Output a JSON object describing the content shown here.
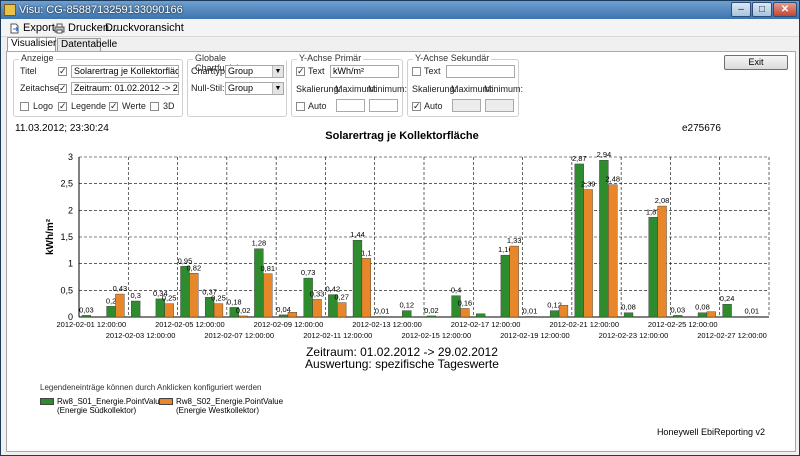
{
  "window": {
    "title": "Visu: CG-8588713259133090166",
    "minimize": "–",
    "maximize": "□",
    "close": "✕"
  },
  "toolbar": {
    "export": "Export",
    "print": "Drucken...",
    "preview": "Druckvoransicht"
  },
  "tabs": [
    "Visualisierung",
    "Datentabelle"
  ],
  "anzeige": {
    "group_label": "Anzeige",
    "titel_label": "Titel",
    "titel_checked": true,
    "titel_value": "Solarertrag je Kollektorfläche",
    "zeitachse_label": "Zeitachse",
    "zeitachse_checked": true,
    "zeitachse_value": "Zeitraum: 01.02.2012 -> 29.02.2012",
    "logo_label": "Logo",
    "logo_checked": false,
    "legende_label": "Legende",
    "legende_checked": true,
    "werte_label": "Werte",
    "werte_checked": true,
    "3d_label": "3D",
    "3d_checked": false
  },
  "global": {
    "group_label": "Globale Chartfunktionen",
    "charttyp_label": "Charttyp:",
    "charttyp_value": "Group",
    "nullstil_label": "Null-Stil:",
    "nullstil_value": "Group"
  },
  "yprimary": {
    "group_label": "Y-Achse Primär",
    "text_label": "Text",
    "text_checked": true,
    "text_value": "kWh/m²",
    "skalierung_label": "Skalierung:",
    "maximum_label": "Maximum:",
    "minimum_label": "Minimum:",
    "auto_label": "Auto",
    "auto_checked": false
  },
  "ysecondary": {
    "group_label": "Y-Achse Sekundär",
    "text_label": "Text",
    "text_checked": false,
    "skalierung_label": "Skalierung:",
    "maximum_label": "Maximum:",
    "minimum_label": "Minimum:",
    "auto_label": "Auto",
    "auto_checked": true
  },
  "exit_label": "Exit",
  "timestamp": "11.03.2012; 23:30:24",
  "report_id": "e275676",
  "caption_line1": "Zeitraum: 01.02.2012 -> 29.02.2012",
  "caption_line2": "Auswertung: spezifische Tageswerte",
  "legend_note": "Legendeneinträge können durch Anklicken konfiguriert werden",
  "legend": [
    {
      "line1": "Rw8_S01_Energie.PointValue",
      "line2": "(Energie Südkollektor)",
      "color": "#2e8b2e"
    },
    {
      "line1": "Rw8_S02_Energie.PointValue",
      "line2": "(Energie Westkollektor)",
      "color": "#e8862a"
    }
  ],
  "brand": "Honeywell EbiReporting v2",
  "chart_data": {
    "type": "bar",
    "title": "Solarertrag je Kollektorfläche",
    "ylabel": "kWh/m²",
    "ylim": [
      0,
      3
    ],
    "yticks": [
      "0",
      "0,5",
      "1",
      "1,5",
      "2",
      "2,5",
      "3"
    ],
    "grid": true,
    "xticks_row1": [
      "2012-02-01 12:00:00",
      "2012-02-05 12:00:00",
      "2012-02-09 12:00:00",
      "2012-02-13 12:00:00",
      "2012-02-17 12:00:00",
      "2012-02-21 12:00:00",
      "2012-02-25 12:00:00"
    ],
    "xticks_row2": [
      "2012-02-03 12:00:00",
      "2012-02-07 12:00:00",
      "2012-02-11 12:00:00",
      "2012-02-15 12:00:00",
      "2012-02-19 12:00:00",
      "2012-02-23 12:00:00",
      "2012-02-27 12:00:00"
    ],
    "series": [
      {
        "name": "Rw8_S01_Energie.PointValue",
        "color": "#2e8b2e",
        "values": [
          0.03,
          0.2,
          0.3,
          0.34,
          0.95,
          0.37,
          0.18,
          1.28,
          0.04,
          0.73,
          0.42,
          1.44,
          0.01,
          0.12,
          0.02,
          0.4,
          0.06,
          1.16,
          0.01,
          0.12,
          2.87,
          2.94,
          0.08,
          1.87,
          0.03,
          0.08,
          0.24,
          0.01
        ],
        "labels": [
          "0,03",
          "0,2",
          "0,3",
          "0,34",
          "0,95",
          "0,37",
          "0,18",
          "1,28",
          "0,04",
          "0,73",
          "0,42",
          "1,44",
          "0,01",
          "0,12",
          "0,02",
          "0,4",
          "",
          "1,16",
          "0,01",
          "0,12",
          "2,87",
          "2,94",
          "0,08",
          "1,87",
          "0,03",
          "0,08",
          "0,24",
          "0,01"
        ]
      },
      {
        "name": "Rw8_S02_Energie.PointValue",
        "color": "#e8862a",
        "values": [
          0.0,
          0.43,
          0.0,
          0.25,
          0.82,
          0.25,
          0.02,
          0.81,
          0.09,
          0.33,
          0.27,
          1.1,
          0.0,
          0.0,
          0.0,
          0.16,
          0.0,
          1.33,
          0.0,
          0.22,
          2.39,
          2.48,
          0.0,
          2.08,
          0.0,
          0.1,
          0.0,
          0.0
        ],
        "labels": [
          "",
          "0,43",
          "",
          "0,25",
          "0,82",
          "0,25",
          "0,02",
          "0,81",
          "",
          "0,33",
          "0,27",
          "1,1",
          "",
          "",
          "",
          "0,16",
          "",
          "1,33",
          "",
          "",
          "2,39",
          "2,48",
          "",
          "2,08",
          "",
          "",
          "",
          ""
        ]
      }
    ]
  }
}
